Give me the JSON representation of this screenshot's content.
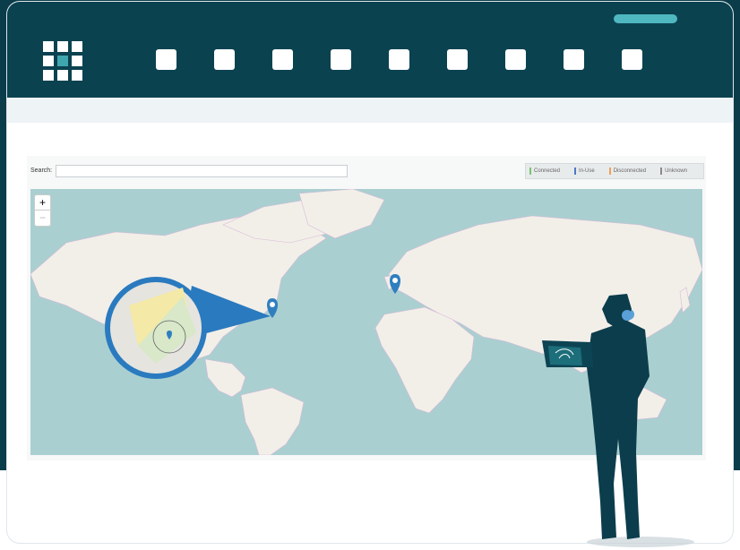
{
  "search": {
    "label": "Search:",
    "value": ""
  },
  "legend": {
    "items": [
      {
        "label": "Connected",
        "color": "#7cc46f"
      },
      {
        "label": "In-Use",
        "color": "#4d78c7"
      },
      {
        "label": "Disconnected",
        "color": "#f0a05a"
      },
      {
        "label": "Unknown",
        "color": "#8a8a8a"
      }
    ]
  },
  "zoom": {
    "plus": "+",
    "minus": "−"
  },
  "colors": {
    "header": "#0b4250",
    "background": "#0b3c49",
    "accent": "#4fb7bf",
    "map_water": "#aacfd0",
    "map_land": "#f2efe9",
    "pin": "#2f7fbf"
  },
  "icons": [
    "grid-menu-icon",
    "nav-icon",
    "map-pin-icon",
    "person-with-laptop-illustration"
  ]
}
